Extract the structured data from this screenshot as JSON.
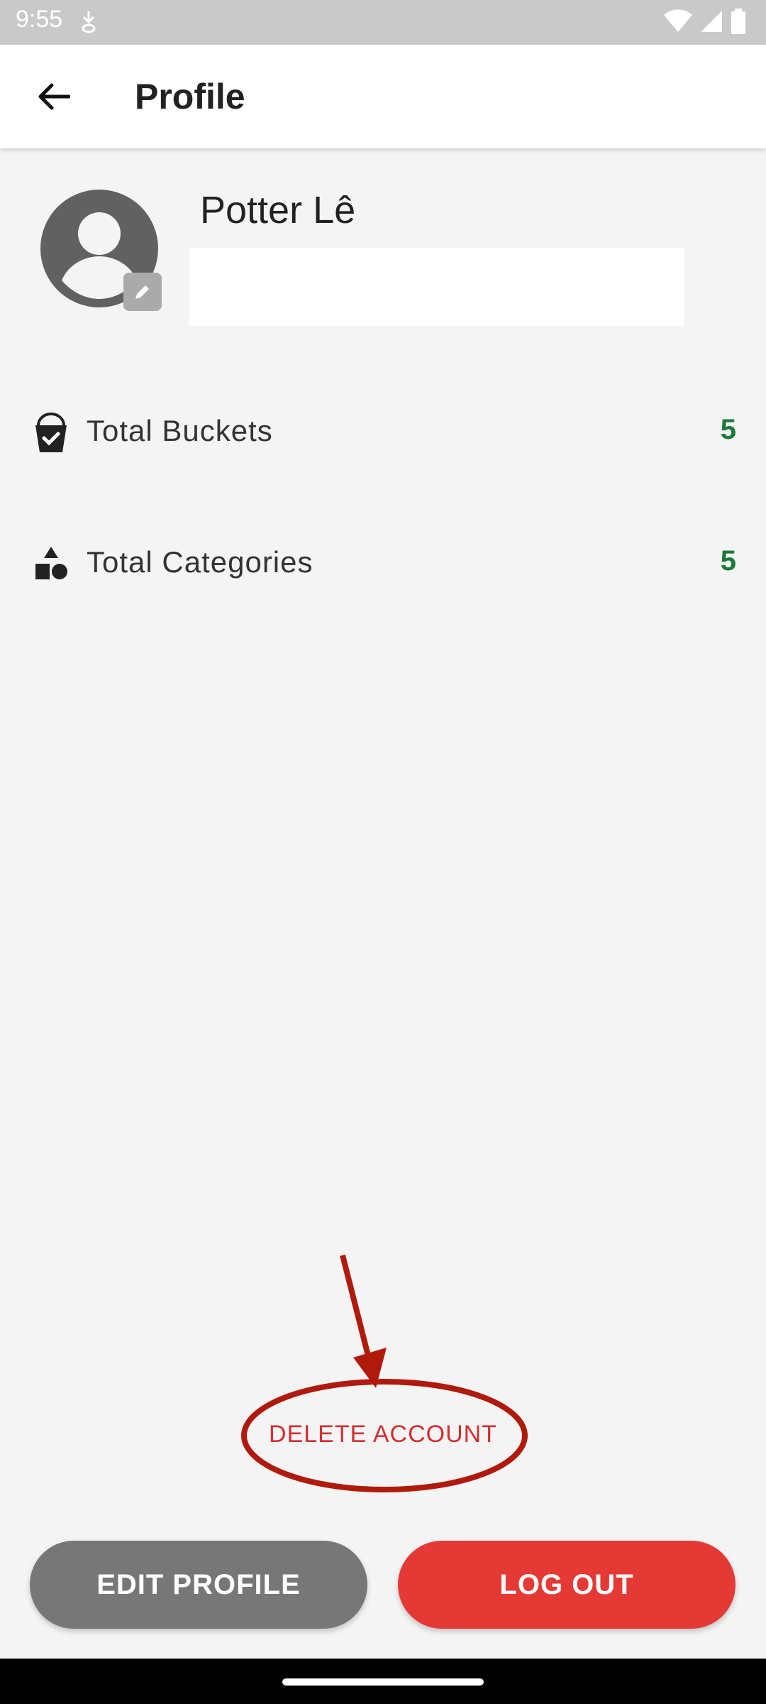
{
  "status_bar": {
    "time": "9:55"
  },
  "app_bar": {
    "title": "Profile"
  },
  "profile": {
    "name": "Potter Lê"
  },
  "stats": [
    {
      "label": "Total Buckets",
      "value": "5",
      "icon": "bucket-icon"
    },
    {
      "label": "Total Categories",
      "value": "5",
      "icon": "shapes-icon"
    }
  ],
  "actions": {
    "delete_account": "DELETE ACCOUNT",
    "edit_profile": "EDIT PROFILE",
    "log_out": "LOG OUT"
  },
  "colors": {
    "accent_red": "#e53935",
    "delete_red": "#d32f2f",
    "stat_green": "#1b7a3a",
    "annotation_red": "#b01a0c",
    "edit_gray": "#777777"
  }
}
